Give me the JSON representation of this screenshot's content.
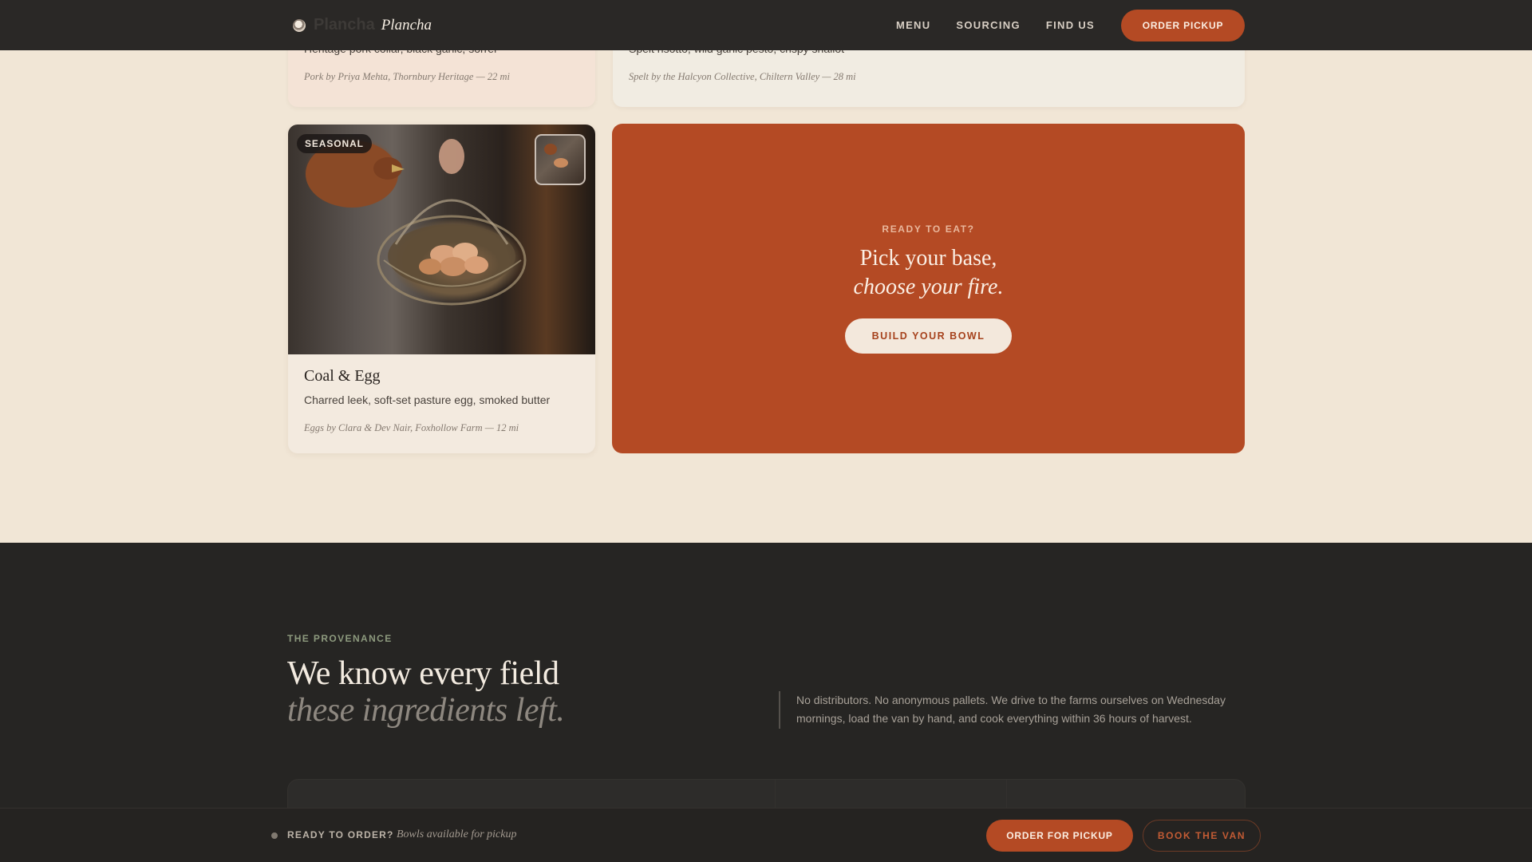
{
  "nav": {
    "brand_ghost": "Plancha",
    "brand_name": "Plancha",
    "links": [
      "MENU",
      "SOURCING",
      "FIND US"
    ],
    "cta": "ORDER PICKUP"
  },
  "cards": {
    "top_left": {
      "description": "Heritage pork collar, black garlic, sorrel",
      "source": "Pork by Priya Mehta, Thornbury Heritage — 22 mi"
    },
    "top_right": {
      "description": "Spelt risotto, wild garlic pesto, crispy shallot",
      "source": "Spelt by the Halcyon Collective, Chiltern Valley — 28 mi"
    },
    "coal_egg": {
      "badge": "SEASONAL",
      "title": "Coal & Egg",
      "description": "Charred leek, soft-set pasture egg, smoked butter",
      "source": "Eggs by Clara & Dev Nair, Foxhollow Farm — 12 mi"
    }
  },
  "cta_card": {
    "kicker": "READY TO EAT?",
    "line1": "Pick your base,",
    "line2": "choose your fire.",
    "button": "BUILD YOUR BOWL"
  },
  "provenance": {
    "kicker": "THE PROVENANCE",
    "headline": "We know every field",
    "headline_italic": "these ingredients left.",
    "body": "No distributors. No anonymous pallets. We drive to the farms ourselves on Wednesday mornings, load the van by hand, and cook everything within 36 hours of harvest."
  },
  "order_bar": {
    "label": "READY TO ORDER?",
    "sub": "Bowls available for pickup",
    "order_button": "ORDER FOR PICKUP",
    "van_button": "BOOK THE VAN"
  },
  "colors": {
    "accent": "#b44a24",
    "cream": "#f1e6d6",
    "dark": "#262523"
  }
}
